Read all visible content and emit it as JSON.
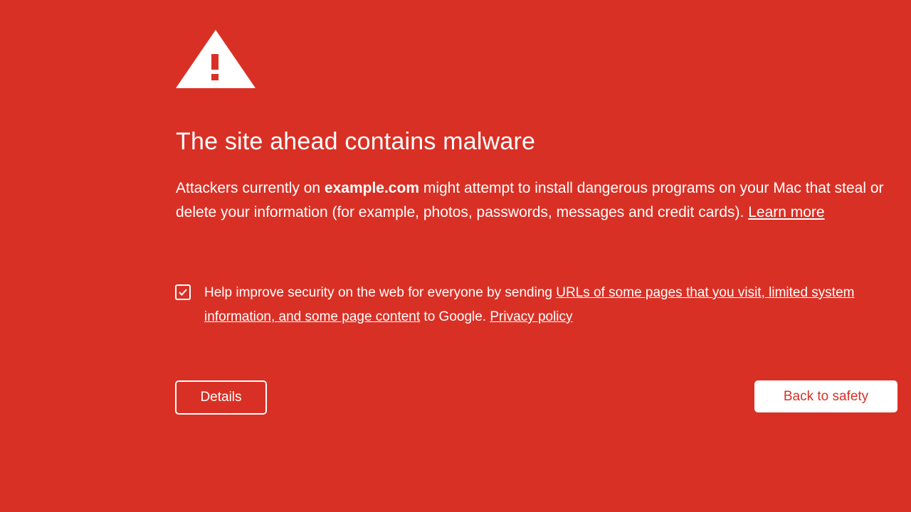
{
  "colors": {
    "background": "#d93025",
    "foreground": "#ffffff",
    "primary_button_text": "#d93025"
  },
  "icons": {
    "warning": "warning-triangle-icon",
    "checkbox": "checkmark-icon"
  },
  "title": "The site ahead contains malware",
  "message": {
    "prefix": "Attackers currently on ",
    "site": "example.com",
    "suffix": " might attempt to install dangerous programs on your Mac that steal or delete your information (for example, photos, passwords, messages and credit cards). ",
    "learn_more": "Learn more"
  },
  "optin": {
    "checked": true,
    "text_before": "Help improve security on the web for everyone by sending ",
    "data_link": "URLs of some pages that you visit, limited system information, and some page content",
    "text_middle": " to Google. ",
    "privacy_link": "Privacy policy"
  },
  "buttons": {
    "details": "Details",
    "back_to_safety": "Back to safety"
  }
}
